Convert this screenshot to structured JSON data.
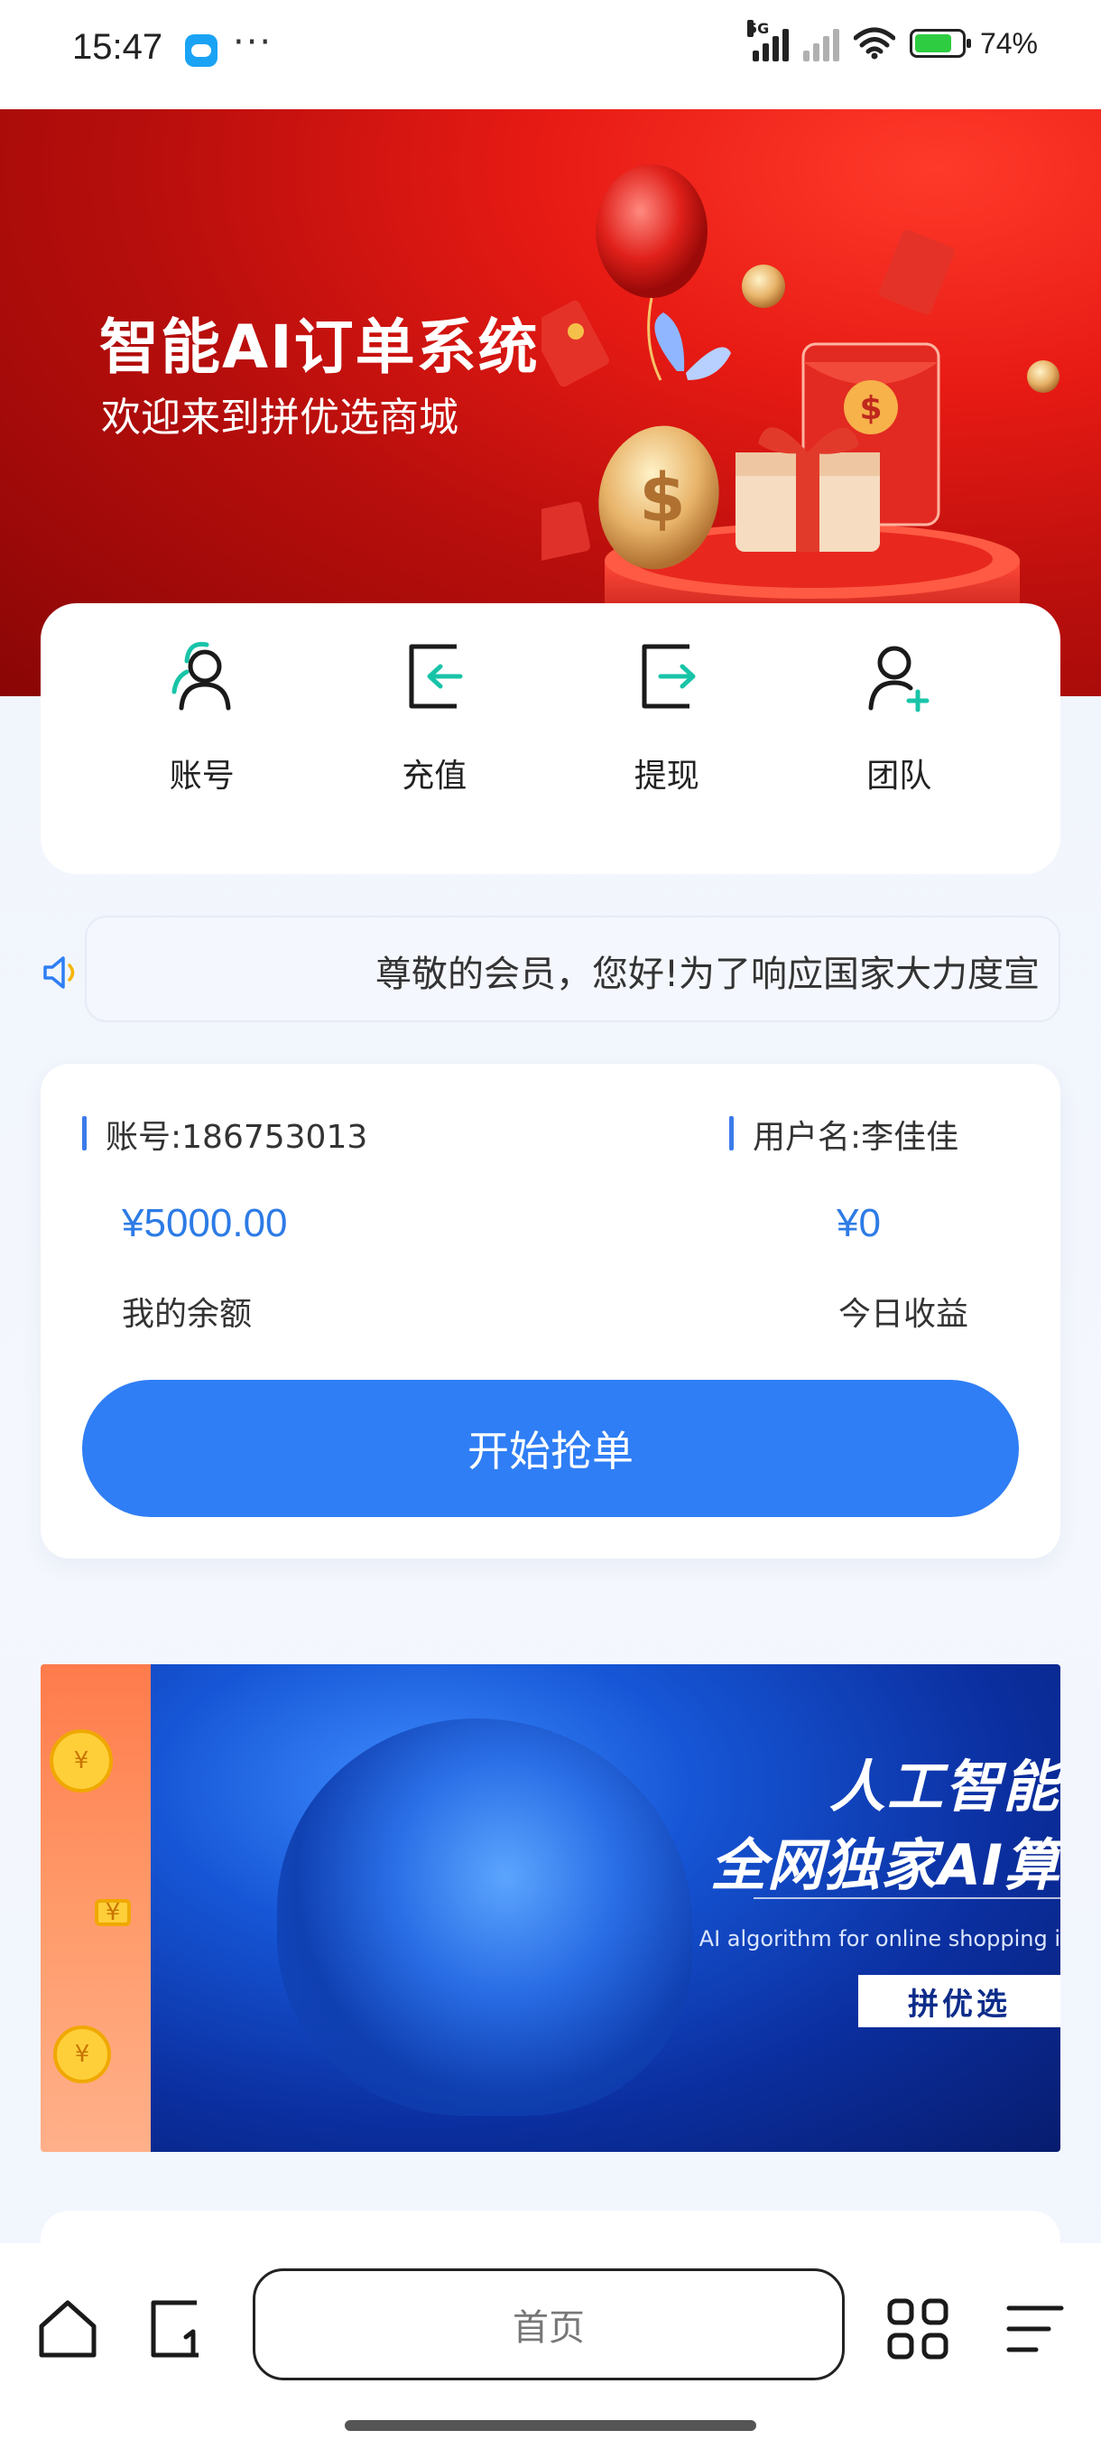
{
  "status_bar": {
    "time": "15:47",
    "more": "···",
    "network_tag": "5G",
    "battery_percent": "74%"
  },
  "hero": {
    "title": "智能AI订单系统",
    "subtitle": "欢迎来到拼优选商城"
  },
  "quick_actions": [
    {
      "label": "账号",
      "icon": "account-icon"
    },
    {
      "label": "充值",
      "icon": "recharge-icon"
    },
    {
      "label": "提现",
      "icon": "withdraw-icon"
    },
    {
      "label": "团队",
      "icon": "team-add-icon"
    }
  ],
  "notice": {
    "text": "尊敬的会员，您好!为了响应国家大力度宣"
  },
  "account": {
    "account_label": "账号:186753013",
    "username_label": "用户名:李佳佳",
    "balance_value": "¥5000.00",
    "balance_caption": "我的余额",
    "today_value": "¥0",
    "today_caption": "今日收益",
    "grab_button": "开始抢单"
  },
  "promo": {
    "title_line1": "人工智能",
    "title_line2": "全网独家AI算",
    "subtitle_en": "AI algorithm for online shopping i",
    "tag": "拼优选"
  },
  "bottom_bar": {
    "address_text": "首页"
  },
  "colors": {
    "accent": "#2f7ef5",
    "teal_icon": "#18c4a8",
    "hero_red": "#e71a14"
  }
}
